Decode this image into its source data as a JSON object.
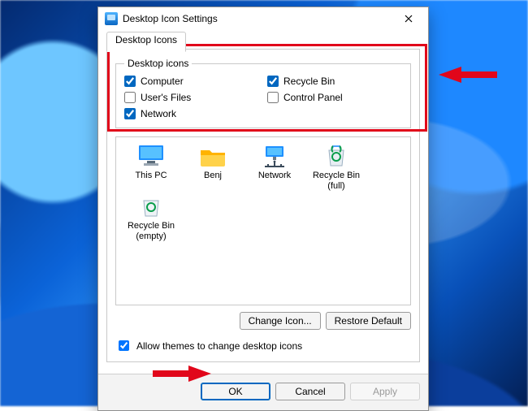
{
  "window": {
    "title": "Desktop Icon Settings"
  },
  "tab": {
    "label": "Desktop Icons"
  },
  "group": {
    "legend": "Desktop icons",
    "items": [
      {
        "id": "computer",
        "label": "Computer",
        "checked": true
      },
      {
        "id": "recycle",
        "label": "Recycle Bin",
        "checked": true
      },
      {
        "id": "userfiles",
        "label": "User's Files",
        "checked": false
      },
      {
        "id": "controlpanel",
        "label": "Control Panel",
        "checked": false
      },
      {
        "id": "network",
        "label": "Network",
        "checked": true
      }
    ]
  },
  "preview": {
    "items": [
      {
        "id": "thispc",
        "label": "This PC",
        "icon": "monitor"
      },
      {
        "id": "userfolder",
        "label": "Benj",
        "icon": "folder"
      },
      {
        "id": "net",
        "label": "Network",
        "icon": "network"
      },
      {
        "id": "rbfull",
        "label": "Recycle Bin (full)",
        "icon": "bin-full"
      },
      {
        "id": "rbempty",
        "label": "Recycle Bin (empty)",
        "icon": "bin-empty"
      }
    ]
  },
  "buttons": {
    "change_icon": "Change Icon...",
    "restore_default": "Restore Default",
    "ok": "OK",
    "cancel": "Cancel",
    "apply": "Apply"
  },
  "allow_themes": {
    "label": "Allow themes to change desktop icons",
    "checked": true
  }
}
